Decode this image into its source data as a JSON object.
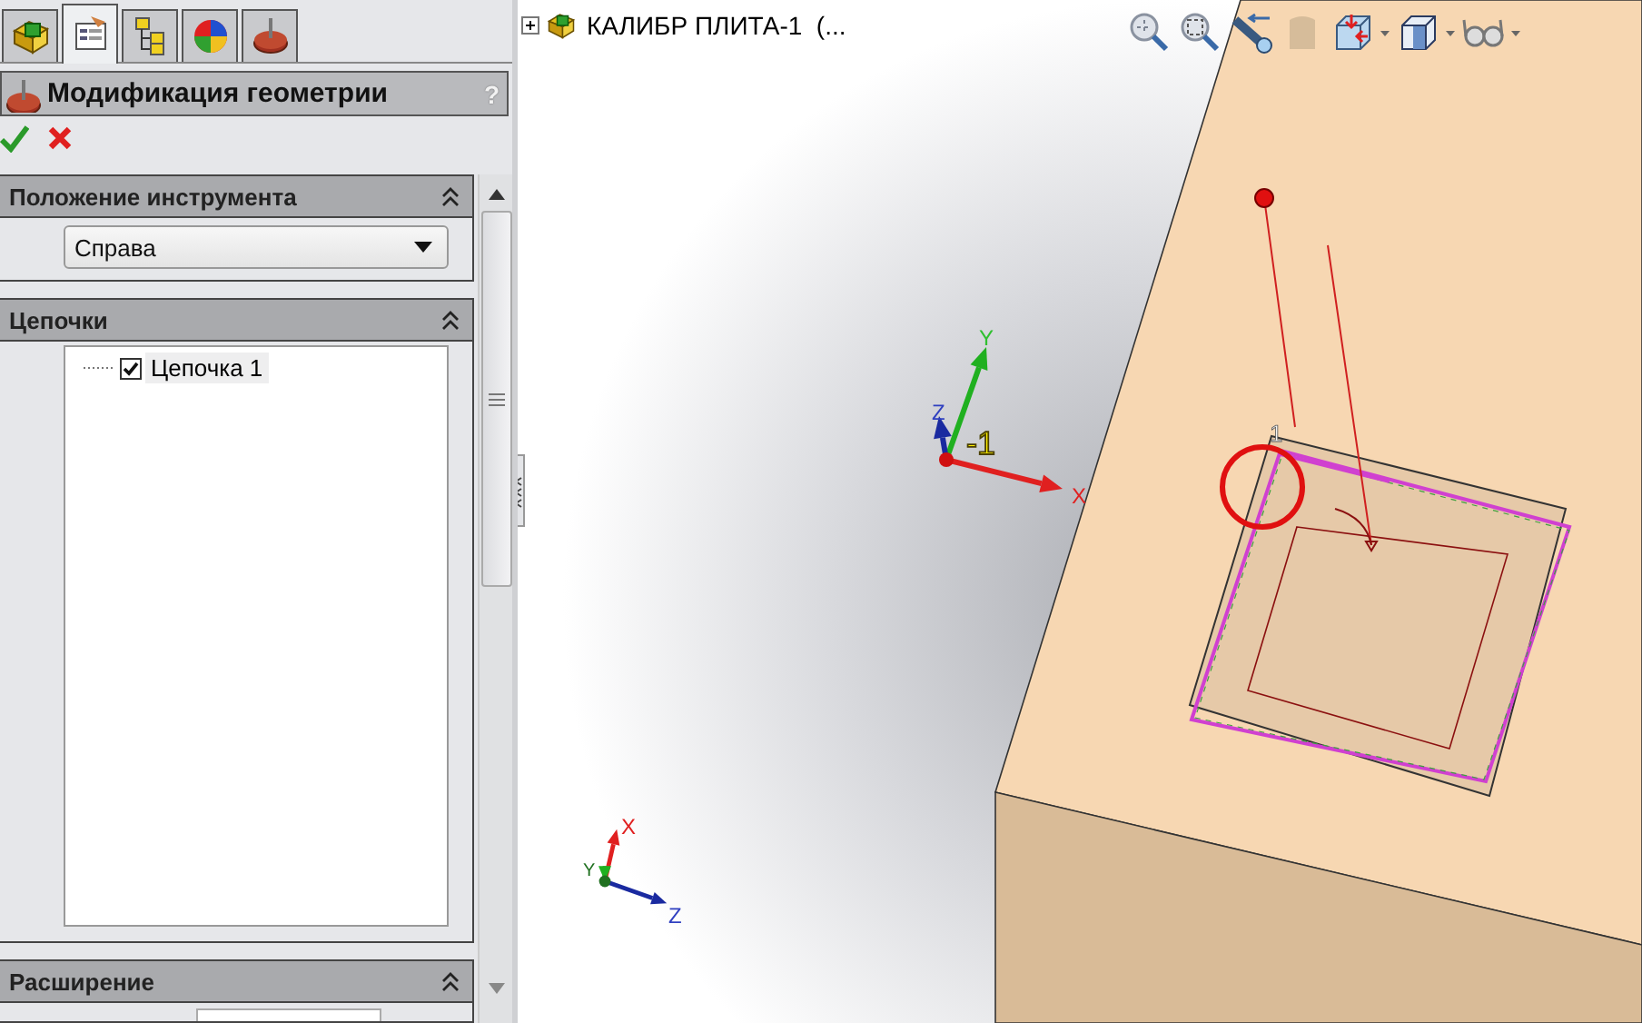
{
  "panel_tabs": [
    {
      "kind": "parts",
      "selected": false
    },
    {
      "kind": "properties",
      "selected": true
    },
    {
      "kind": "tree",
      "selected": false
    },
    {
      "kind": "appearance",
      "selected": false
    },
    {
      "kind": "cam",
      "selected": false
    }
  ],
  "property_manager": {
    "title": "Модификация геометрии",
    "help": "?"
  },
  "sections": [
    {
      "kind": "dropdown",
      "title": "Положение инструмента",
      "expanded": true,
      "value": "Справа"
    },
    {
      "kind": "list",
      "title": "Цепочки",
      "expanded": true,
      "items": [
        {
          "label": "Цепочка 1",
          "checked": true
        }
      ]
    },
    {
      "kind": "partial",
      "title": "Расширение",
      "expanded": true
    }
  ],
  "feature_tree": {
    "label": "КАЛИБР ПЛИТА-1  (...",
    "expanded": false
  },
  "triads": [
    {
      "kind": "main",
      "x": "X",
      "y": "Y",
      "z": "Z",
      "tag": "-1"
    },
    {
      "kind": "small",
      "x": "X",
      "y": "Y",
      "z": "Z"
    }
  ],
  "corner_label": "1"
}
